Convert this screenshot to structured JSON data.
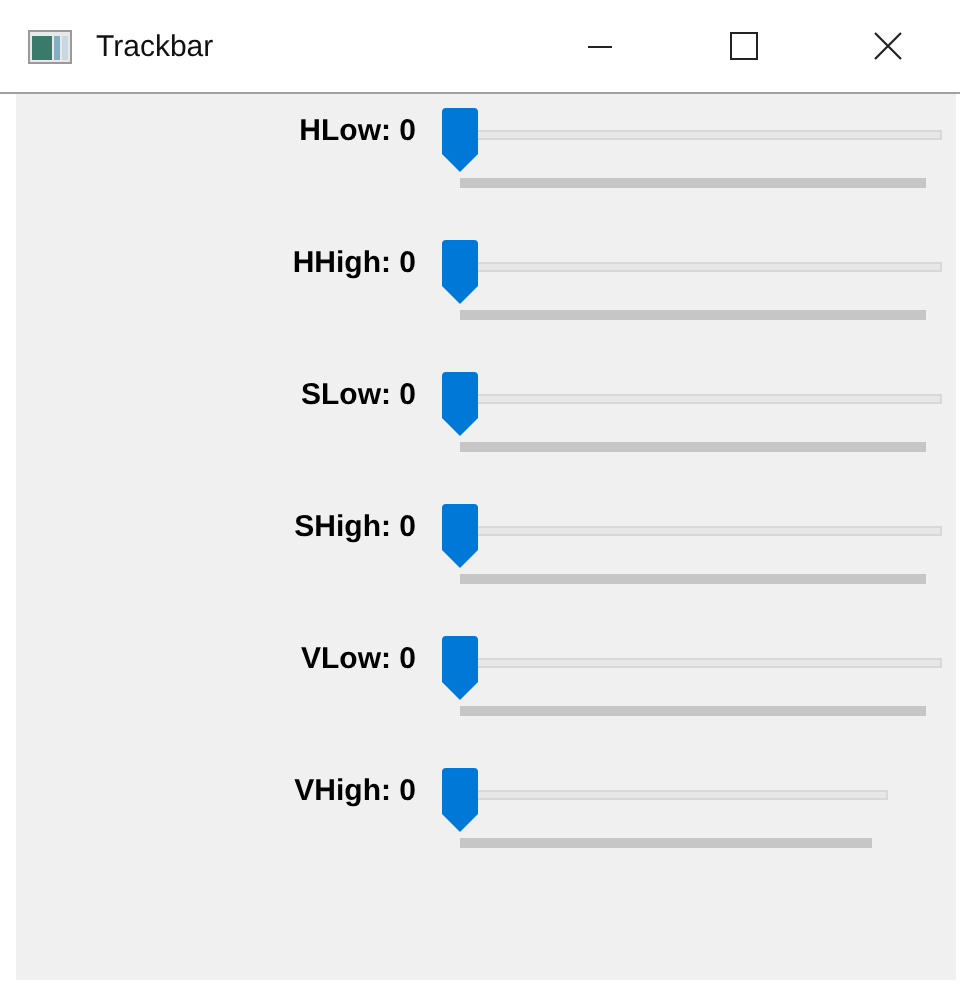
{
  "window": {
    "title": "Trackbar"
  },
  "trackbars": [
    {
      "label": "HLow: 0",
      "level": 0
    },
    {
      "label": "HHigh: 0",
      "level": 0
    },
    {
      "label": "SLow: 0",
      "level": 0
    },
    {
      "label": "SHigh: 0",
      "level": 0
    },
    {
      "label": "VLow: 0",
      "level": 0
    },
    {
      "label": "VHigh: 0",
      "level": 0
    }
  ]
}
